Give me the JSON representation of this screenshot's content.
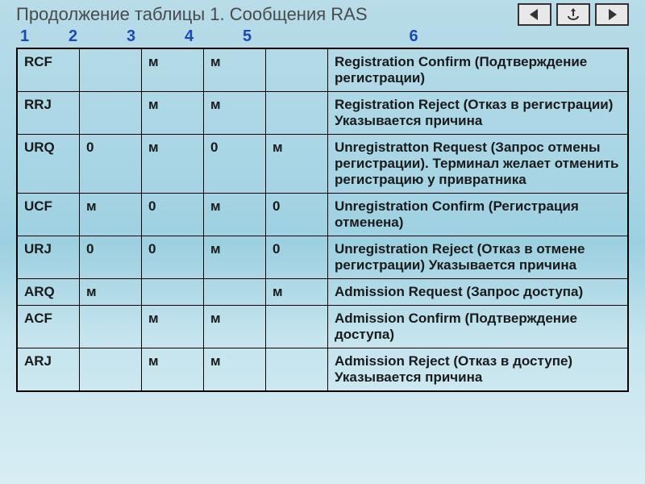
{
  "title": "Продолжение таблицы 1. Сообщения RAS",
  "columns": [
    "1",
    "2",
    "3",
    "4",
    "5",
    "6"
  ],
  "rows": [
    {
      "code": "RCF",
      "c2": "",
      "c3": "м",
      "c4": "м",
      "c5": "",
      "desc": "Registration Confirm (Подтверждение регистрации)"
    },
    {
      "code": "RRJ",
      "c2": "",
      "c3": "м",
      "c4": "м",
      "c5": "",
      "desc": "Registration Reject (Отказ в регистрации) Указывается причина"
    },
    {
      "code": "URQ",
      "c2": "0",
      "c3": "м",
      "c4": "0",
      "c5": "м",
      "desc": "Unregistratton Request (Запрос отмены регистрации). Терминал желает отменить регистрацию у привратника"
    },
    {
      "code": "UCF",
      "c2": "м",
      "c3": "0",
      "c4": "м",
      "c5": "0",
      "desc": "Unregistration Confirm (Регистрация отменена)"
    },
    {
      "code": "URJ",
      "c2": "0",
      "c3": "0",
      "c4": "м",
      "c5": "0",
      "desc": "Unregistration Reject (Отказ в отмене регистрации) Указывается причина"
    },
    {
      "code": "ARQ",
      "c2": "м",
      "c3": "",
      "c4": "",
      "c5": "м",
      "desc": "Admission Request (Запрос доступа)"
    },
    {
      "code": "ACF",
      "c2": "",
      "c3": "м",
      "c4": "м",
      "c5": "",
      "desc": "Admission Confirm (Подтверждение доступа)"
    },
    {
      "code": "ARJ",
      "c2": "",
      "c3": "м",
      "c4": "м",
      "c5": "",
      "desc": "Admission Reject (Отказ в доступе) Указывается причина"
    }
  ]
}
